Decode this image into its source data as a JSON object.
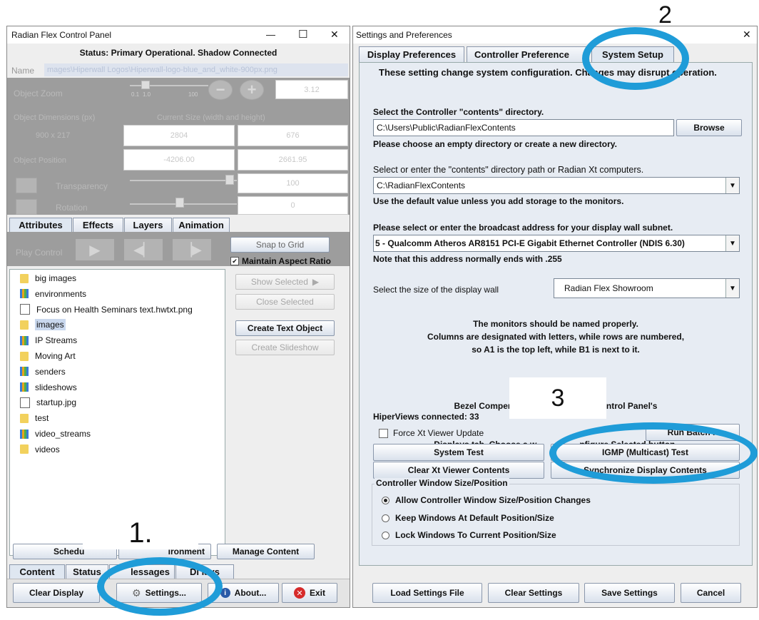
{
  "left_window": {
    "title": "Radian Flex Control Panel",
    "controls": {
      "minimize": "—",
      "maximize": "☐",
      "close": "✕"
    },
    "status": "Status: Primary Operational. Shadow Connected",
    "name_label": "Name",
    "name_value": "mages\\Hiperwall Logos\\Hiperwall-logo-blue_and_white-900px.png",
    "object_zoom_label": "Object Zoom",
    "zoom_ticks": {
      "t1": "0.1",
      "t2": "1.0",
      "t3": "100"
    },
    "zoom_value": "3.12",
    "dimensions_label": "Object Dimensions (px)",
    "current_size_label": "Current Size (width and height)",
    "dimensions_value": "900 x 217",
    "width_value": "2804",
    "height_value": "676",
    "position_label": "Object Position",
    "pos_x": "-4206.00",
    "pos_y": "2661.95",
    "transparency_label": "Transparency",
    "transparency_value": "100",
    "rotation_label": "Rotation",
    "rotation_value": "0",
    "tabs": [
      "Attributes",
      "Effects",
      "Layers",
      "Animation"
    ],
    "play_control_label": "Play Control",
    "snap_to_grid": "Snap to Grid",
    "maintain_aspect": "Maintain Aspect Ratio",
    "tree_items": [
      {
        "label": "big images",
        "icon": "folder"
      },
      {
        "label": "environments",
        "icon": "grid"
      },
      {
        "label": "Focus on Health Seminars text.hwtxt.png",
        "icon": "file"
      },
      {
        "label": "images",
        "icon": "folder"
      },
      {
        "label": "IP Streams",
        "icon": "grid"
      },
      {
        "label": "Moving Art",
        "icon": "folder"
      },
      {
        "label": "senders",
        "icon": "grid"
      },
      {
        "label": "slideshows",
        "icon": "grid"
      },
      {
        "label": "startup.jpg",
        "icon": "file"
      },
      {
        "label": "test",
        "icon": "folder"
      },
      {
        "label": "video_streams",
        "icon": "grid"
      },
      {
        "label": "videos",
        "icon": "folder"
      }
    ],
    "show_selected": "Show Selected",
    "close_selected": "Close Selected",
    "create_text_object": "Create Text Object",
    "create_slideshow": "Create Slideshow",
    "schedule_btn": "Schedu",
    "environment_btn": "ironment",
    "manage_content": "Manage Content",
    "bottom_tabs": {
      "content": "Content",
      "status": "Status",
      "messages": "lessages",
      "displays": "Di   lays"
    },
    "clear_display": "Clear Display",
    "settings_btn": "Settings...",
    "about_btn": "About...",
    "exit_btn": "Exit"
  },
  "right_window": {
    "title": "Settings and Preferences",
    "close": "✕",
    "tabs": [
      "Display Preferences",
      "Controller Preference",
      "System Setup"
    ],
    "warning": "These setting change system configuration. Changes may disrupt operation.",
    "contents_dir_label": "Select the Controller \"contents\" directory.",
    "contents_dir_value": "C:\\Users\\Public\\RadianFlexContents",
    "browse": "Browse",
    "contents_dir_hint": "Please choose an empty directory or create a new directory.",
    "xt_dir_label": "Select or enter the \"contents\" directory path or Radian Xt computers.",
    "xt_dir_value": "C:\\RadianFlexContents",
    "xt_dir_hint": "Use the default value unless you add storage to the monitors.",
    "broadcast_label": "Please select or enter the broadcast address for your display wall subnet.",
    "broadcast_value": "5 - Qualcomm Atheros AR8151 PCI-E Gigabit Ethernet Controller (NDIS 6.30)",
    "broadcast_hint": "Note that this address normally ends with .255",
    "wall_size_label": "Select the size of the display wall",
    "wall_size_value": "Radian Flex Showroom",
    "monitors_info": [
      "The monitors should be named properly.",
      "Columns are designated with letters, while rows are numbered,",
      "so A1 is the top left, while B1 is next to it."
    ],
    "bezel_info": [
      "Bezel Compensation s          to the Control Panel's",
      "Displays tab. Choose a w                  nfigure Selected button."
    ],
    "hiperviews": "HiperViews connected: 33",
    "force_update": "Force Xt Viewer Update",
    "run_batch": "Run Batch F",
    "system_test": "System Test",
    "igmp_test": "IGMP (Multicast) Test",
    "clear_xt": "Clear Xt Viewer Contents",
    "sync_display": "Synchronize Display Contents",
    "window_group_title": "Controller Window Size/Position",
    "radio_options": [
      "Allow Controller Window Size/Position Changes",
      "Keep Windows At Default Position/Size",
      "Lock Windows To Current Position/Size"
    ],
    "load_settings": "Load Settings File",
    "clear_settings": "Clear Settings",
    "save_settings": "Save Settings",
    "cancel": "Cancel"
  },
  "annotations": {
    "step1": "1.",
    "step2": "2",
    "step3": "3"
  },
  "colors": {
    "annotation_circle": "#1f9cd8",
    "panel_bg": "#eeeeee",
    "disabled_panel": "#9d9d9d",
    "tab_bg": "#dfe7f1"
  }
}
